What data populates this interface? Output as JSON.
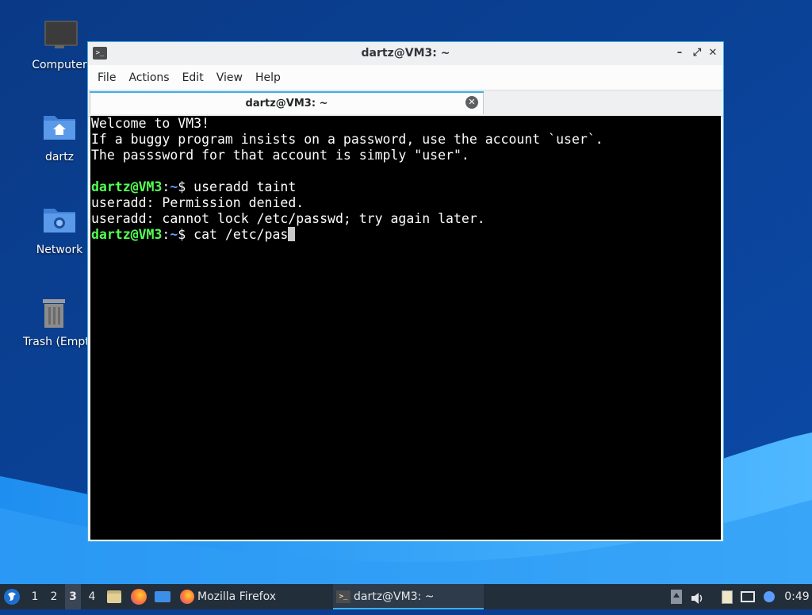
{
  "desktop": {
    "icons": [
      {
        "label": "Computer",
        "icon": "monitor-icon"
      },
      {
        "label": "dartz",
        "icon": "home-folder-icon"
      },
      {
        "label": "Network",
        "icon": "network-folder-icon"
      },
      {
        "label": "Trash (Empty)",
        "icon": "trash-icon"
      }
    ]
  },
  "window": {
    "title": "dartz@VM3: ~",
    "menu": [
      "File",
      "Actions",
      "Edit",
      "View",
      "Help"
    ],
    "tab": {
      "label": "dartz@VM3: ~"
    }
  },
  "terminal": {
    "motd": [
      "Welcome to VM3!",
      "If a buggy program insists on a password, use the account `user`.",
      "The passsword for that account is simply \"user\"."
    ],
    "prompt": {
      "user_host": "dartz@VM3",
      "sep": ":",
      "path": "~",
      "symbol": "$ "
    },
    "cmd1": "useradd taint",
    "output": [
      "useradd: Permission denied.",
      "useradd: cannot lock /etc/passwd; try again later."
    ],
    "cmd2": "cat /etc/pas"
  },
  "taskbar": {
    "workspaces": [
      "1",
      "2",
      "3",
      "4"
    ],
    "active_workspace": "3",
    "tasks": [
      {
        "label": "Mozilla Firefox",
        "icon": "firefox-icon"
      },
      {
        "label": "dartz@VM3: ~",
        "icon": "terminal-icon"
      }
    ],
    "clock": "0:49"
  },
  "colors": {
    "accent": "#3daee9",
    "prompt_user": "#54ff54",
    "prompt_path": "#5b9cff",
    "taskbar_bg": "#232e3b"
  }
}
